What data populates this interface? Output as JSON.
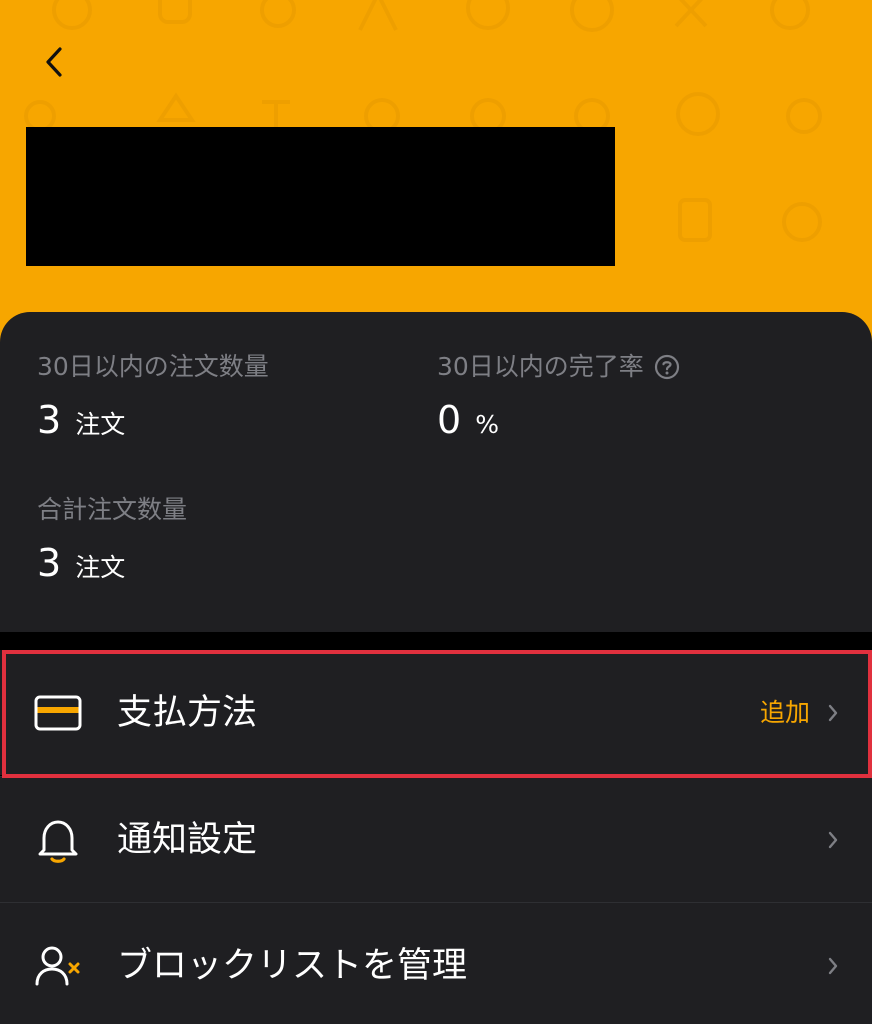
{
  "header": {
    "background": "#F7A600",
    "redacted_color": "#000000"
  },
  "stats": {
    "orders_30d": {
      "label": "30日以内の注文数量",
      "value": "3",
      "unit": "注文"
    },
    "completion_30d": {
      "label": "30日以内の完了率",
      "value": "0",
      "unit": "%"
    },
    "total_orders": {
      "label": "合計注文数量",
      "value": "3",
      "unit": "注文"
    }
  },
  "menu": {
    "payment": {
      "label": "支払方法",
      "action": "追加",
      "icon": "credit-card-icon"
    },
    "notifications": {
      "label": "通知設定",
      "icon": "bell-icon"
    },
    "blocklist": {
      "label": "ブロックリストを管理",
      "icon": "user-block-icon"
    }
  },
  "colors": {
    "accent": "#F7A600",
    "card": "#1F1F22",
    "muted_text": "#7E7F85",
    "highlight": "#E0303E"
  }
}
